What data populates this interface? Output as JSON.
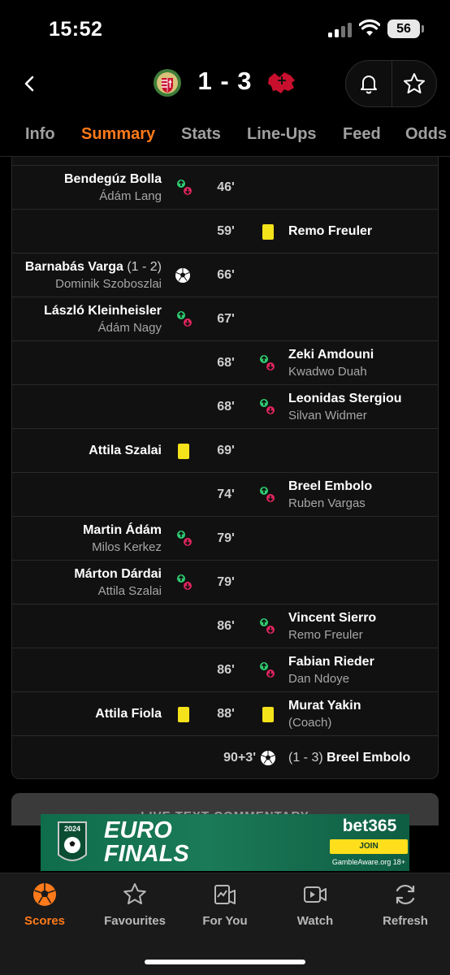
{
  "status_bar": {
    "time": "15:52",
    "battery": "56"
  },
  "header": {
    "score": "1 - 3",
    "home_team_icon": "hungary-crest-icon",
    "away_team_icon": "switzerland-crest-icon"
  },
  "tabs": [
    {
      "label": "Info",
      "active": false
    },
    {
      "label": "Summary",
      "active": true
    },
    {
      "label": "Stats",
      "active": false
    },
    {
      "label": "Line-Ups",
      "active": false
    },
    {
      "label": "Feed",
      "active": false
    },
    {
      "label": "Odds",
      "active": false
    }
  ],
  "events": [
    {
      "minute": "46'",
      "side": "home",
      "type": "substitution",
      "player": "Bendegúz Bolla",
      "detail": "Ádám Lang"
    },
    {
      "minute": "59'",
      "side": "away",
      "type": "yellow-card",
      "player": "Remo Freuler",
      "detail": ""
    },
    {
      "minute": "66'",
      "side": "home",
      "type": "goal",
      "player": "Barnabás Varga",
      "score_note": "(1 - 2)",
      "detail": "Dominik Szoboszlai"
    },
    {
      "minute": "67'",
      "side": "home",
      "type": "substitution",
      "player": "László Kleinheisler",
      "detail": "Ádám Nagy"
    },
    {
      "minute": "68'",
      "side": "away",
      "type": "substitution",
      "player": "Zeki Amdouni",
      "detail": "Kwadwo Duah"
    },
    {
      "minute": "68'",
      "side": "away",
      "type": "substitution",
      "player": "Leonidas Stergiou",
      "detail": "Silvan Widmer"
    },
    {
      "minute": "69'",
      "side": "home",
      "type": "yellow-card",
      "player": "Attila Szalai",
      "detail": ""
    },
    {
      "minute": "74'",
      "side": "away",
      "type": "substitution",
      "player": "Breel Embolo",
      "detail": "Ruben Vargas"
    },
    {
      "minute": "79'",
      "side": "home",
      "type": "substitution",
      "player": "Martin Ádám",
      "detail": "Milos Kerkez"
    },
    {
      "minute": "79'",
      "side": "home",
      "type": "substitution",
      "player": "Márton Dárdai",
      "detail": "Attila Szalai"
    },
    {
      "minute": "86'",
      "side": "away",
      "type": "substitution",
      "player": "Vincent Sierro",
      "detail": "Remo Freuler"
    },
    {
      "minute": "86'",
      "side": "away",
      "type": "substitution",
      "player": "Fabian Rieder",
      "detail": "Dan Ndoye"
    },
    {
      "minute": "88'",
      "side": "both",
      "type": "yellow-card",
      "home_player": "Attila Fiola",
      "player": "Murat Yakin",
      "detail": "(Coach)"
    },
    {
      "minute": "90+3'",
      "side": "away",
      "type": "goal",
      "score_note": "(1 - 3)",
      "player": "Breel Embolo",
      "detail": ""
    }
  ],
  "commentary_label": "LIVE TEXT COMMENTARY",
  "ad": {
    "badge_year": "2024",
    "headline_1": "EURO",
    "headline_2": "FINALS",
    "brand": "bet365",
    "cta": "JOIN",
    "disclaimer": "GambleAware.org 18+"
  },
  "bottom_nav": [
    {
      "label": "Scores",
      "icon": "football-icon",
      "active": true
    },
    {
      "label": "Favourites",
      "icon": "star-icon",
      "active": false
    },
    {
      "label": "For You",
      "icon": "for-you-icon",
      "active": false
    },
    {
      "label": "Watch",
      "icon": "video-icon",
      "active": false
    },
    {
      "label": "Refresh",
      "icon": "refresh-icon",
      "active": false
    }
  ],
  "colors": {
    "accent": "#ff7a1a",
    "yellow_card": "#f4e21a",
    "sub_in": "#2ecc71",
    "sub_out": "#e0245e"
  }
}
